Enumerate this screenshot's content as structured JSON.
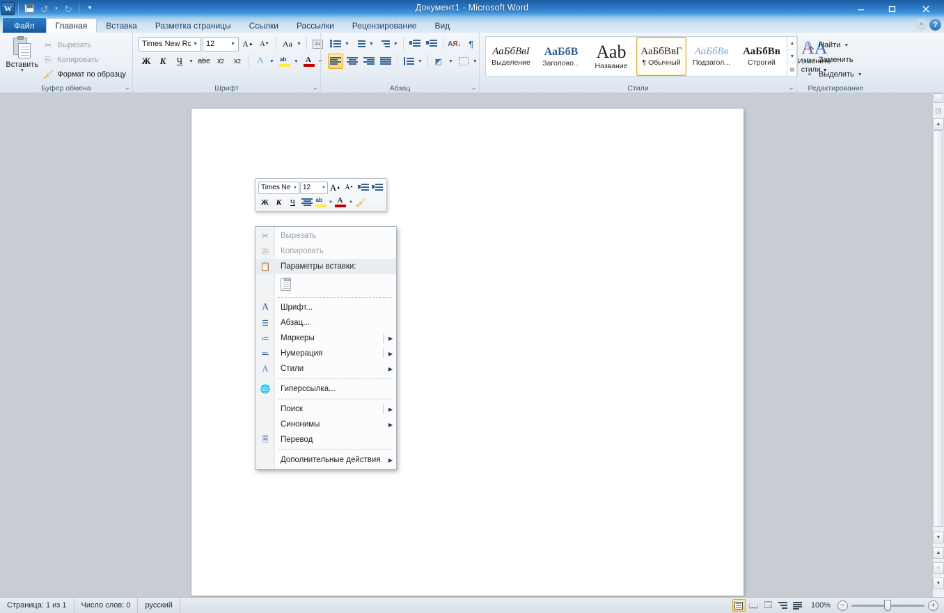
{
  "window": {
    "title": "Документ1  -  Microsoft Word",
    "app_icon": "word-icon",
    "quick_access": [
      {
        "name": "save-icon",
        "label": "Сохранить"
      },
      {
        "name": "undo-icon",
        "label": "Отменить"
      },
      {
        "name": "redo-icon",
        "label": "Вернуть"
      },
      {
        "name": "customize-qat-icon",
        "label": "Настройка панели быстрого доступа"
      }
    ],
    "controls": [
      {
        "name": "minimize-button",
        "glyph": "—"
      },
      {
        "name": "maximize-button",
        "glyph": "❐"
      },
      {
        "name": "close-button",
        "glyph": "✕"
      }
    ],
    "ribbon_collapse_label": "^",
    "help_label": "?"
  },
  "tabs": [
    {
      "label": "Файл",
      "kind": "file"
    },
    {
      "label": "Главная",
      "kind": "active"
    },
    {
      "label": "Вставка",
      "kind": "normal"
    },
    {
      "label": "Разметка страницы",
      "kind": "normal"
    },
    {
      "label": "Ссылки",
      "kind": "normal"
    },
    {
      "label": "Рассылки",
      "kind": "normal"
    },
    {
      "label": "Рецензирование",
      "kind": "normal"
    },
    {
      "label": "Вид",
      "kind": "normal"
    }
  ],
  "ribbon": {
    "clipboard": {
      "group_label": "Буфер обмена",
      "paste_label": "Вставить",
      "items": [
        {
          "label": "Вырезать",
          "icon": "scissors-icon",
          "enabled": false
        },
        {
          "label": "Копировать",
          "icon": "copy-icon",
          "enabled": false
        },
        {
          "label": "Формат по образцу",
          "icon": "format-painter-icon",
          "enabled": true
        }
      ]
    },
    "font": {
      "group_label": "Шрифт",
      "font_name": "Times New Rc",
      "font_size": "12",
      "buttons_row1": [
        {
          "name": "grow-font-button",
          "label": "A"
        },
        {
          "name": "shrink-font-button",
          "label": "A"
        },
        {
          "name": "change-case-button",
          "label": "Aa"
        },
        {
          "name": "clear-formatting-button",
          "label": "Aa"
        }
      ],
      "buttons_row2": [
        {
          "name": "bold-button",
          "label": "Ж"
        },
        {
          "name": "italic-button",
          "label": "К"
        },
        {
          "name": "underline-button",
          "label": "Ч"
        },
        {
          "name": "strikethrough-button",
          "label": "abc"
        },
        {
          "name": "subscript-button",
          "label": "x₂"
        },
        {
          "name": "superscript-button",
          "label": "x²"
        },
        {
          "name": "text-effects-button",
          "label": "A"
        },
        {
          "name": "highlight-color-button",
          "label": "ab"
        },
        {
          "name": "font-color-button",
          "label": "A"
        }
      ]
    },
    "paragraph": {
      "group_label": "Абзац",
      "buttons_row1": [
        {
          "name": "bullets-button",
          "label": "Маркеры"
        },
        {
          "name": "numbering-button",
          "label": "Нумерация"
        },
        {
          "name": "multilevel-list-button",
          "label": "Многоуровневый список"
        },
        {
          "name": "decrease-indent-button",
          "label": "Уменьшить отступ"
        },
        {
          "name": "increase-indent-button",
          "label": "Увеличить отступ"
        },
        {
          "name": "sort-button",
          "label": "Сортировка"
        },
        {
          "name": "show-marks-button",
          "label": "¶"
        }
      ],
      "buttons_row2": [
        {
          "name": "align-left-button",
          "label": "По левому краю",
          "selected": true
        },
        {
          "name": "align-center-button",
          "label": "По центру",
          "selected": false
        },
        {
          "name": "align-right-button",
          "label": "По правому краю",
          "selected": false
        },
        {
          "name": "justify-button",
          "label": "По ширине",
          "selected": false
        },
        {
          "name": "line-spacing-button",
          "label": "Междустрочный интервал"
        },
        {
          "name": "shading-button",
          "label": "Заливка"
        },
        {
          "name": "borders-button",
          "label": "Границы"
        }
      ]
    },
    "styles": {
      "group_label": "Стили",
      "items": [
        {
          "preview": "АаБбВвІ",
          "name": "Выделение",
          "style": "emphasis",
          "selected": false
        },
        {
          "preview": "АаБбВ",
          "name": "Заголово...",
          "style": "heading",
          "selected": false
        },
        {
          "preview": "Ааb",
          "name": "Название",
          "style": "title",
          "selected": false
        },
        {
          "preview": "АаБбВвГ",
          "name": "¶ Обычный",
          "style": "normal",
          "selected": true
        },
        {
          "preview": "АаБбВв",
          "name": "Подзагол...",
          "style": "subtitle",
          "selected": false
        },
        {
          "preview": "АаБбВв",
          "name": "Строгий",
          "style": "strong",
          "selected": false
        }
      ],
      "change_styles_label": "Изменить\nстили"
    },
    "editing": {
      "group_label": "Редактирование",
      "items": [
        {
          "label": "Найти",
          "icon": "find-icon",
          "has_arrow": true
        },
        {
          "label": "Заменить",
          "icon": "replace-icon",
          "has_arrow": false
        },
        {
          "label": "Выделить",
          "icon": "select-icon",
          "has_arrow": true
        }
      ]
    }
  },
  "mini_toolbar": {
    "font_name": "Times Ne",
    "font_size": "12",
    "row1": [
      {
        "name": "grow-font-button",
        "label": "A"
      },
      {
        "name": "shrink-font-button",
        "label": "A"
      },
      {
        "name": "decrease-indent-button",
        "label": "Уменьшить отступ"
      },
      {
        "name": "increase-indent-button",
        "label": "Увеличить отступ"
      }
    ],
    "row2": [
      {
        "name": "bold-button",
        "label": "Ж"
      },
      {
        "name": "italic-button",
        "label": "К"
      },
      {
        "name": "underline-button",
        "label": "Ч"
      },
      {
        "name": "align-center-button",
        "label": "По центру"
      },
      {
        "name": "highlight-color-button",
        "label": "ab"
      },
      {
        "name": "font-color-button",
        "label": "A"
      },
      {
        "name": "format-painter-button",
        "label": "Формат по образцу"
      }
    ]
  },
  "context_menu": {
    "paste_options_label": "Параметры вставки:",
    "paste_option_icon": "keep-source-formatting-icon",
    "items": [
      {
        "label": "Вырезать",
        "icon": "scissors-icon",
        "enabled": false,
        "submenu": false,
        "separator_after": false
      },
      {
        "label": "Копировать",
        "icon": "copy-icon",
        "enabled": false,
        "submenu": false,
        "separator_after": false
      },
      {
        "label": "Параметры вставки:",
        "icon": "paste-icon",
        "enabled": true,
        "submenu": false,
        "separator_after": false,
        "highlighted": true
      },
      {
        "label": "Шрифт...",
        "icon": "font-icon",
        "enabled": true,
        "submenu": false,
        "separator_after": false
      },
      {
        "label": "Абзац...",
        "icon": "paragraph-icon",
        "enabled": true,
        "submenu": false,
        "separator_after": false
      },
      {
        "label": "Маркеры",
        "icon": "bullets-icon",
        "enabled": true,
        "submenu": true,
        "separator_after": false
      },
      {
        "label": "Нумерация",
        "icon": "numbering-icon",
        "enabled": true,
        "submenu": true,
        "separator_after": false
      },
      {
        "label": "Стили",
        "icon": "styles-icon",
        "enabled": true,
        "submenu": true,
        "separator_after": true
      },
      {
        "label": "Гиперссылка...",
        "icon": "hyperlink-icon",
        "enabled": true,
        "submenu": false,
        "separator_after": true
      },
      {
        "label": "Поиск",
        "icon": "none",
        "enabled": true,
        "submenu": true,
        "separator_after": false
      },
      {
        "label": "Синонимы",
        "icon": "none",
        "enabled": true,
        "submenu": true,
        "separator_after": false
      },
      {
        "label": "Перевод",
        "icon": "translate-icon",
        "enabled": true,
        "submenu": false,
        "separator_after": true
      },
      {
        "label": "Дополнительные действия",
        "icon": "none",
        "enabled": true,
        "submenu": true,
        "separator_after": false
      }
    ]
  },
  "status_bar": {
    "page": "Страница: 1 из 1",
    "words": "Число слов: 0",
    "language": "русский",
    "view_buttons": [
      {
        "name": "print-layout-view-button",
        "selected": true
      },
      {
        "name": "full-screen-reading-view-button",
        "selected": false
      },
      {
        "name": "web-layout-view-button",
        "selected": false
      },
      {
        "name": "outline-view-button",
        "selected": false
      },
      {
        "name": "draft-view-button",
        "selected": false
      }
    ],
    "zoom": "100%",
    "zoom_out_label": "−",
    "zoom_in_label": "+"
  },
  "document": {
    "content": ""
  }
}
